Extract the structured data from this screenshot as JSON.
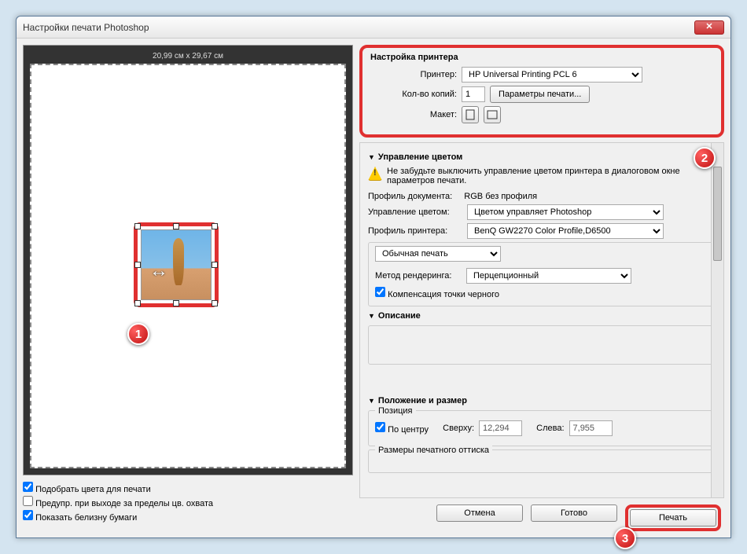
{
  "window": {
    "title": "Настройки печати Photoshop"
  },
  "preview": {
    "dimensions": "20,99 см x 29,67 см"
  },
  "left_checks": {
    "match_colors": "Подобрать цвета для печати",
    "gamut_warning": "Предупр. при выходе за пределы цв. охвата",
    "paper_white": "Показать белизну бумаги"
  },
  "printer_setup": {
    "title": "Настройка принтера",
    "printer_label": "Принтер:",
    "printer_value": "HP Universal Printing PCL 6",
    "copies_label": "Кол-во копий:",
    "copies_value": "1",
    "print_params_btn": "Параметры печати...",
    "layout_label": "Макет:"
  },
  "color_mgmt": {
    "title": "Управление цветом",
    "warning": "Не забудьте выключить управление цветом принтера в диалоговом окне параметров печати.",
    "doc_profile_label": "Профиль документа:",
    "doc_profile_value": "RGB без профиля",
    "handling_label": "Управление цветом:",
    "handling_value": "Цветом управляет Photoshop",
    "printer_profile_label": "Профиль принтера:",
    "printer_profile_value": "BenQ GW2270 Color Profile,D6500",
    "print_mode": "Обычная печать",
    "rendering_label": "Метод рендеринга:",
    "rendering_value": "Перцепционный",
    "black_point": "Компенсация точки черного"
  },
  "description": {
    "title": "Описание"
  },
  "position": {
    "title": "Положение и размер",
    "pos_group": "Позиция",
    "center": "По центру",
    "top_label": "Сверху:",
    "top_value": "12,294",
    "left_label": "Слева:",
    "left_value": "7,955",
    "size_group": "Размеры печатного оттиска"
  },
  "footer": {
    "cancel": "Отмена",
    "done": "Готово",
    "print": "Печать"
  },
  "badges": {
    "b1": "1",
    "b2": "2",
    "b3": "3"
  }
}
